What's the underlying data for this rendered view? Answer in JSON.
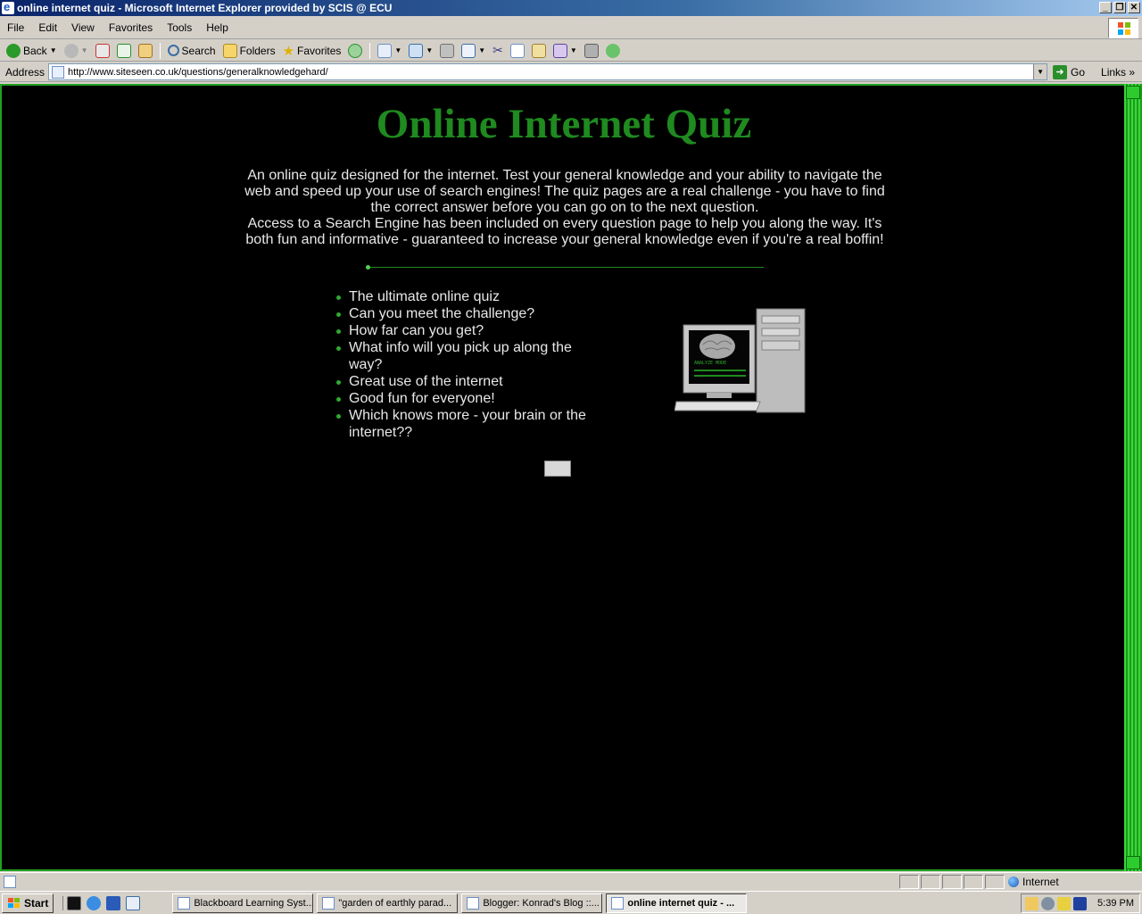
{
  "window": {
    "title": "online internet quiz - Microsoft Internet Explorer provided by SCIS @ ECU",
    "buttons": [
      "_",
      "❐",
      "✕"
    ]
  },
  "menu": [
    "File",
    "Edit",
    "View",
    "Favorites",
    "Tools",
    "Help"
  ],
  "toolbar": {
    "back_label": "Back",
    "search_label": "Search",
    "folders_label": "Folders",
    "favorites_label": "Favorites"
  },
  "address": {
    "label": "Address",
    "url": "http://www.siteseen.co.uk/questions/generalknowledgehard/",
    "go_label": "Go",
    "links_label": "Links"
  },
  "page": {
    "heading": "Online Internet Quiz",
    "intro_1": "An online quiz designed for the internet. Test your general knowledge and your ability to navigate the web and speed up your use of search engines! The quiz pages are a real challenge - you have to find the correct answer before you can go on to the next question.",
    "intro_2": "Access to a Search Engine has been included on every question page to help you along the way. It's both fun and informative - guaranteed to increase your general knowledge even if you're a real boffin!",
    "features": [
      "The ultimate online quiz",
      "Can you meet the challenge?",
      "How far can you get?",
      "What info will you pick up along the way?",
      "Great use of the internet",
      "Good fun for everyone!",
      "Which knows more - your brain or the internet??"
    ],
    "monitor_text": "ANALYZE MODE",
    "colors": {
      "heading": "#1f8a1f",
      "background": "#000000",
      "text": "#e8e8e8"
    }
  },
  "status": {
    "zone": "Internet"
  },
  "taskbar": {
    "start_label": "Start",
    "tasks": [
      "Blackboard Learning Syst...",
      "\"garden of earthly parad...",
      "Blogger: Konrad's Blog ::...",
      "online internet quiz - ..."
    ],
    "clock": "5:39 PM"
  }
}
